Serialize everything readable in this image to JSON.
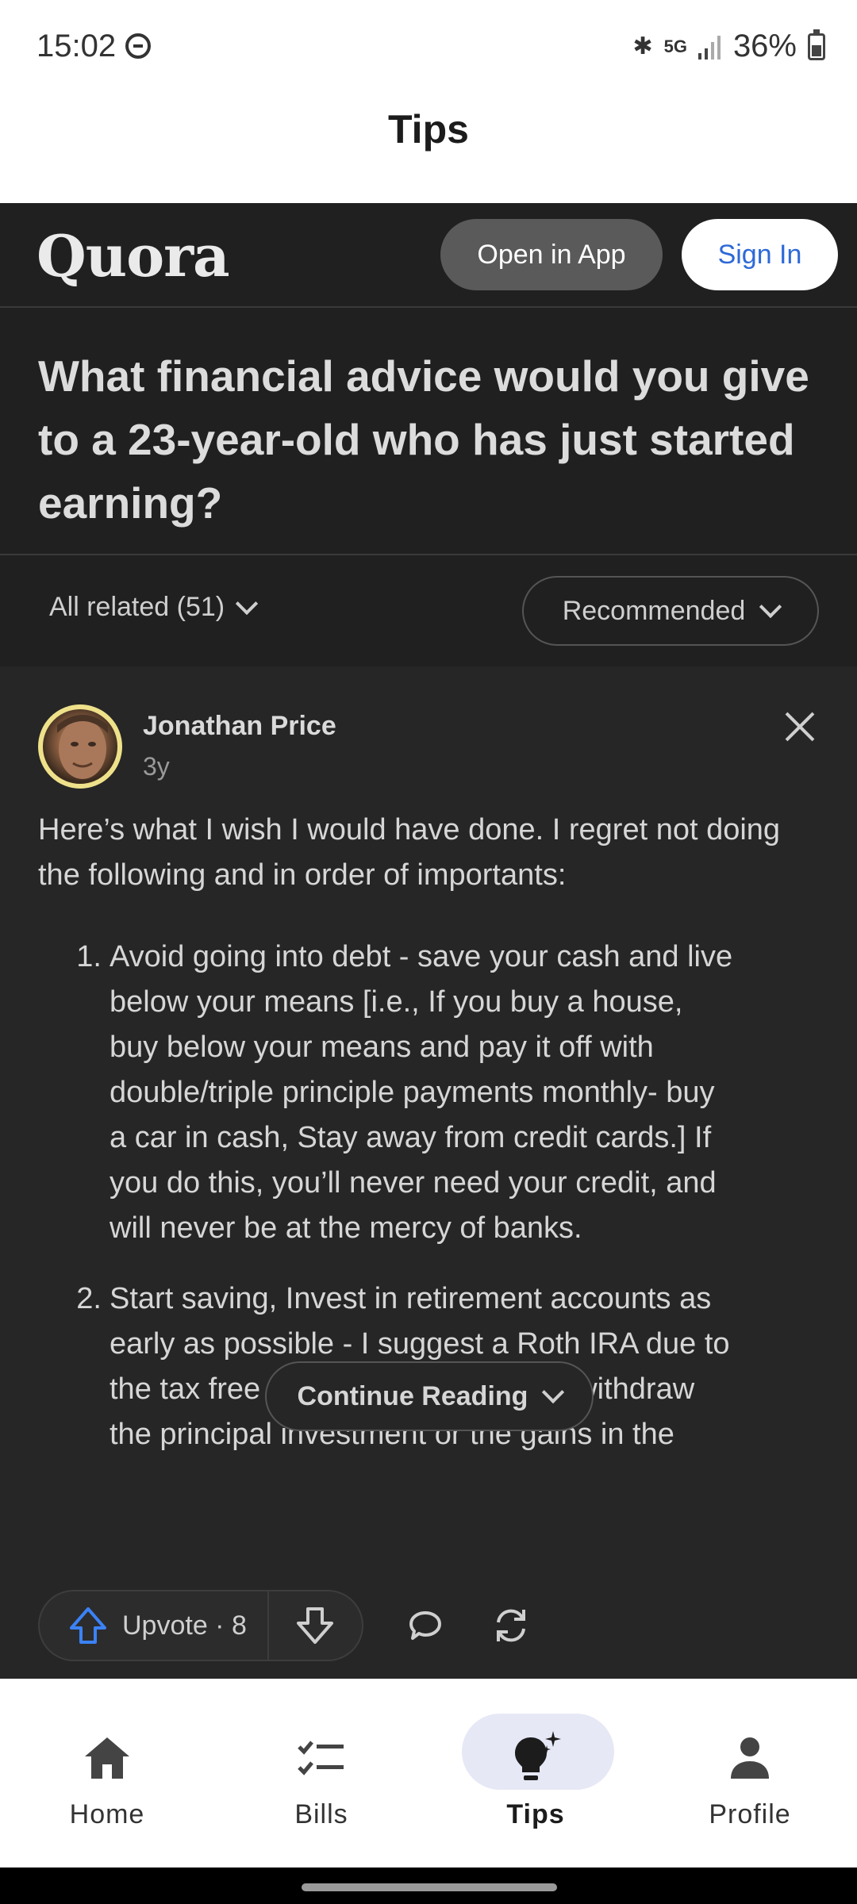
{
  "status_bar": {
    "time": "15:02",
    "battery": "36%"
  },
  "app_header": {
    "title": "Tips"
  },
  "quora_header": {
    "logo": "Quora",
    "open_in_app": "Open in App",
    "sign_in": "Sign In"
  },
  "question": {
    "title": "What financial advice would you give to a 23-year-old who has just started earning?"
  },
  "filters": {
    "all_related": "All related (51)",
    "sort": "Recommended"
  },
  "answer": {
    "author": "Jonathan Price",
    "age": "3y",
    "intro": "Here’s what I wish I would have done. I regret not doing the following and in order of importants:",
    "items": [
      {
        "num": "1.",
        "text": "Avoid going into debt - save your cash and live below your means [i.e., If you buy a house, buy below your means and pay it off with double/triple principle payments monthly- buy a car in cash, Stay away from credit cards.] If you do this, you’ll never need your credit, and will never be at the mercy of banks."
      },
      {
        "num": "2.",
        "text": "Start saving, Invest in retirement accounts as early as possible - I suggest a Roth IRA due to the tax free distributions when you withdraw the principal investment or the gains in the"
      }
    ],
    "continue_label": "Continue Reading",
    "upvote_label": "Upvote · 8"
  },
  "bottom_nav": {
    "items": [
      {
        "label": "Home",
        "icon": "home-icon"
      },
      {
        "label": "Bills",
        "icon": "checklist-icon"
      },
      {
        "label": "Tips",
        "icon": "lightbulb-icon",
        "active": true
      },
      {
        "label": "Profile",
        "icon": "person-icon"
      }
    ]
  },
  "colors": {
    "accent": "#2e69d7",
    "dark_bg": "#202020",
    "card_bg": "#262626",
    "active_pill": "#e6e8f5"
  }
}
